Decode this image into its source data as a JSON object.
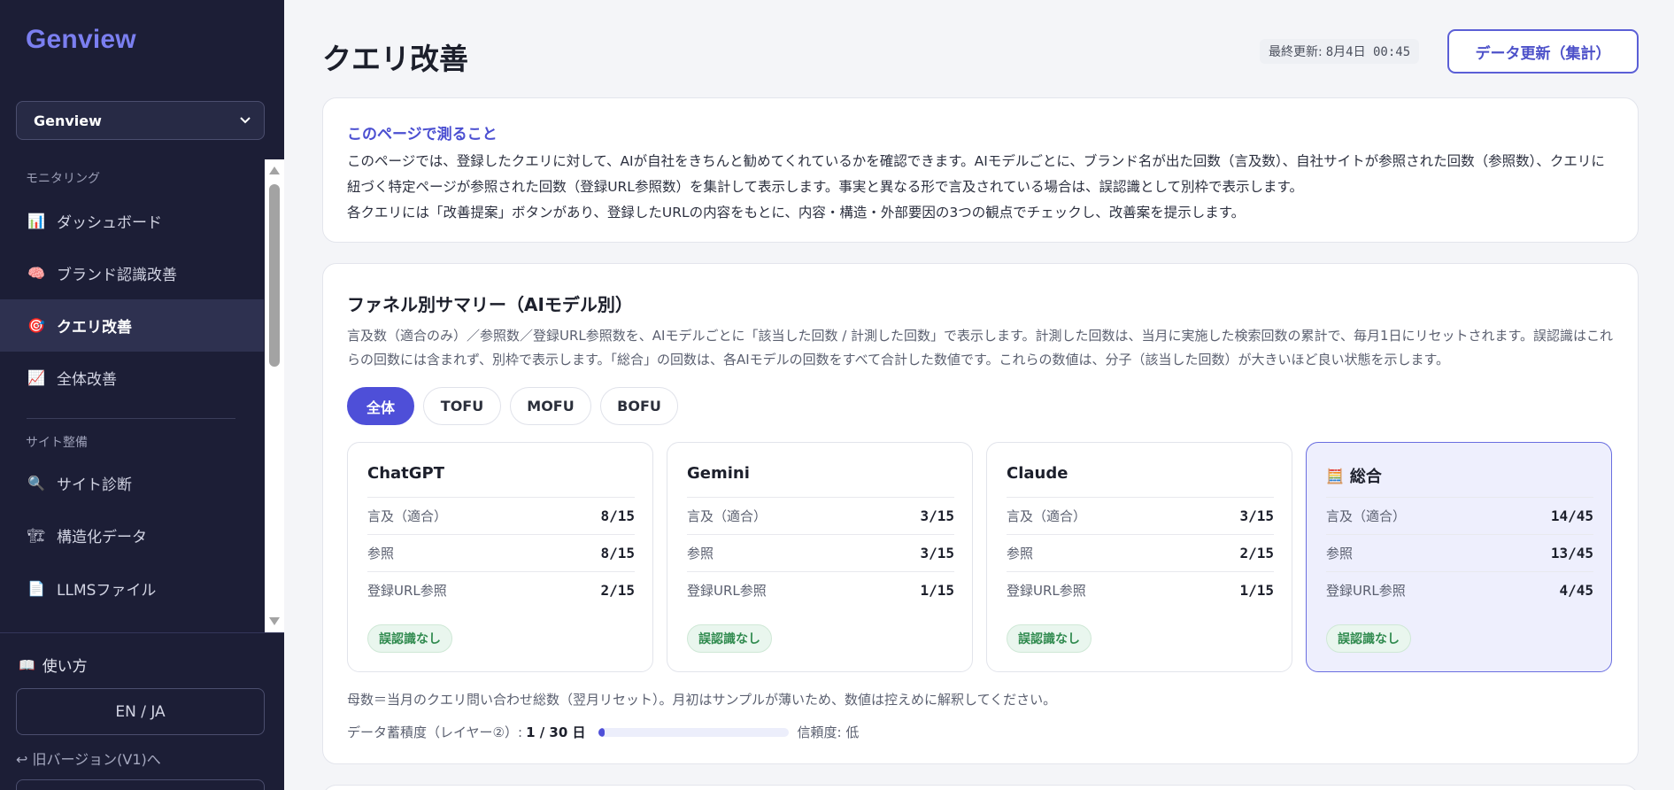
{
  "sidebar": {
    "brand": "Genview",
    "workspace": "Genview",
    "sections": {
      "monitoring": "モニタリング",
      "site": "サイト整備"
    },
    "items": [
      {
        "label": "ダッシュボード",
        "icon": "bar-chart-icon",
        "glyph": "📊",
        "active": false
      },
      {
        "label": "ブランド認識改善",
        "icon": "brain-icon",
        "glyph": "🧠",
        "active": false
      },
      {
        "label": "クエリ改善",
        "icon": "target-icon",
        "glyph": "🎯",
        "active": true
      },
      {
        "label": "全体改善",
        "icon": "trend-up-icon",
        "glyph": "📈",
        "active": false
      },
      {
        "label": "サイト診断",
        "icon": "magnifier-icon",
        "glyph": "🔍",
        "active": false
      },
      {
        "label": "構造化データ",
        "icon": "structure-icon",
        "glyph": "🏗",
        "active": false
      },
      {
        "label": "LLMSファイル",
        "icon": "document-icon",
        "glyph": "📄",
        "active": false
      }
    ],
    "howto": "使い方",
    "howto_glyph": "📖",
    "lang": "EN / JA",
    "old_version": "↩ 旧バージョン(V1)へ"
  },
  "header": {
    "title": "クエリ改善",
    "last_updated_label": "最終更新:",
    "last_updated_value": "8月4日 00:45",
    "refresh_button": "データ更新（集計）"
  },
  "intro": {
    "heading": "このページで測ること",
    "line1": "このページでは、登録したクエリに対して、AIが自社をきちんと勧めてくれているかを確認できます。AIモデルごとに、ブランド名が出た回数（言及数）、自社サイトが参照された回数（参照数）、クエリに紐づく特定ページが参照された回数（登録URL参照数）を集計して表示します。事実と異なる形で言及されている場合は、誤認識として別枠で表示します。",
    "line2": "各クエリには「改善提案」ボタンがあり、登録したURLの内容をもとに、内容・構造・外部要因の3つの観点でチェックし、改善案を提示します。"
  },
  "funnel": {
    "title": "ファネル別サマリー（AIモデル別）",
    "description": "言及数（適合のみ）／参照数／登録URL参照数を、AIモデルごとに「該当した回数 / 計測した回数」で表示します。計測した回数は、当月に実施した検索回数の累計で、毎月1日にリセットされます。誤認識はこれらの回数には含まれず、別枠で表示します。「総合」の回数は、各AIモデルの回数をすべて合計した数値です。これらの数値は、分子（該当した回数）が大きいほど良い状態を示します。",
    "tabs": [
      {
        "label": "全体",
        "active": true
      },
      {
        "label": "TOFU",
        "active": false
      },
      {
        "label": "MOFU",
        "active": false
      },
      {
        "label": "BOFU",
        "active": false
      }
    ],
    "metric_labels": {
      "mention": "言及（適合）",
      "reference": "参照",
      "url_reference": "登録URL参照"
    },
    "models": [
      {
        "name": "ChatGPT",
        "mention": "8/15",
        "reference": "8/15",
        "url_reference": "2/15",
        "badge": "誤認識なし"
      },
      {
        "name": "Gemini",
        "mention": "3/15",
        "reference": "3/15",
        "url_reference": "1/15",
        "badge": "誤認識なし"
      },
      {
        "name": "Claude",
        "mention": "3/15",
        "reference": "2/15",
        "url_reference": "1/15",
        "badge": "誤認識なし"
      },
      {
        "name": "総合",
        "icon": "abacus-icon",
        "glyph": "🧮",
        "mention": "14/45",
        "reference": "13/45",
        "url_reference": "4/45",
        "badge": "誤認識なし"
      }
    ],
    "footnote": "母数＝当月のクエリ問い合わせ総数（翌月リセット）。月初はサンプルが薄いため、数値は控えめに解釈してください。",
    "accumulation_label": "データ蓄積度（レイヤー②）:",
    "accumulation_value": "1 / 30 日",
    "accumulation_fraction": 0.033,
    "reliability": "信頼度: 低"
  },
  "colors": {
    "accent": "#4e4fd8",
    "sidebar_bg": "#1c1e36",
    "success": "#2f8a4e"
  }
}
